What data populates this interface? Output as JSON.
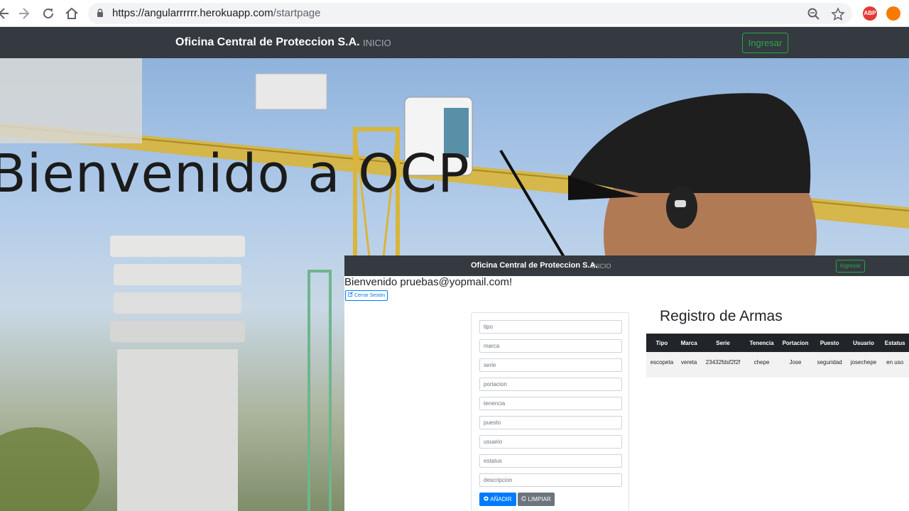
{
  "browser": {
    "url_host": "https://angularrrrrr.herokuapp.com",
    "url_path": "/startpage",
    "ext_abp_label": "ABP",
    "icons": [
      "back-arrow-icon",
      "forward-arrow-icon",
      "reload-icon",
      "home-icon",
      "lock-icon",
      "zoom-icon",
      "star-icon"
    ]
  },
  "outer": {
    "brand": "Oficina Central de Proteccion S.A.",
    "nav_link": "INICIO",
    "login_label": "Ingresar",
    "hero_title": "Bienvenido a OCP"
  },
  "inner": {
    "brand": "Oficina Central de Proteccion S.A.",
    "nav_link": "INICIO",
    "login_label": "Ingresar",
    "welcome": "Bienvenido pruebas@yopmail.com!",
    "logout_label": "Cerrar Sesión",
    "form": {
      "placeholders": [
        "tipo",
        "marca",
        "serie",
        "portacion",
        "tenencia",
        "puesto",
        "usuario",
        "estatus",
        "descripcion"
      ],
      "add_label": "AÑADIR",
      "clear_label": "LIMPIAR"
    },
    "registry": {
      "title": "Registro de Armas",
      "columns": [
        "Tipo",
        "Marca",
        "Serie",
        "Tenencia",
        "Portacion",
        "Puesto",
        "Usuario",
        "Estatus"
      ],
      "rows": [
        [
          "escopeta",
          "vereta",
          "23432fdsf2f2f",
          "chepe",
          "Jose",
          "seguridad",
          "josechepe",
          "en uso"
        ]
      ]
    }
  },
  "colors": {
    "navbar": "#343a40",
    "success": "#28a745",
    "primary": "#007bff",
    "secondary": "#6c757d"
  }
}
